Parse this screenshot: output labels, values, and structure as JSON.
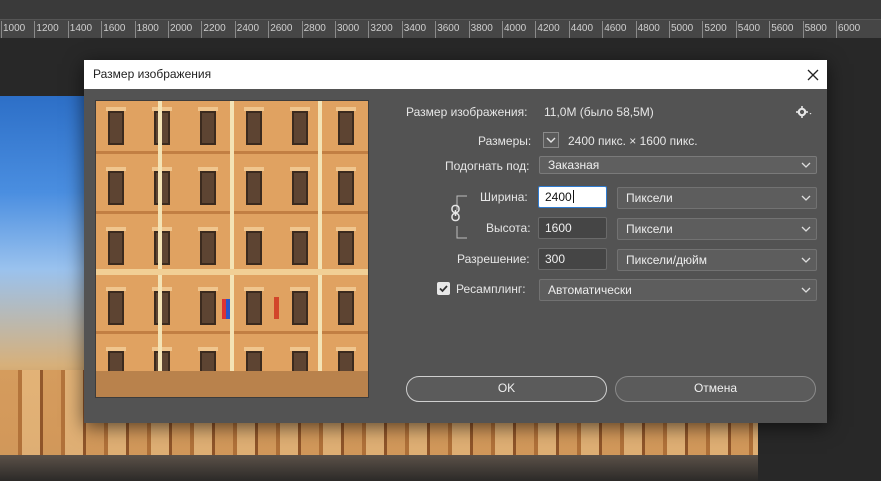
{
  "ruler": {
    "labels": [
      "1000",
      "1200",
      "1400",
      "1600",
      "1800",
      "2000",
      "2200",
      "2400",
      "2600",
      "2800",
      "3000",
      "3200",
      "3400",
      "3600",
      "3800",
      "4000",
      "4200",
      "4400",
      "4600",
      "4800",
      "5000",
      "5200",
      "5400",
      "5600",
      "5800",
      "6000"
    ]
  },
  "dialog": {
    "title": "Размер изображения",
    "image_size_label": "Размер изображения:",
    "image_size_value": "11,0M (было 58,5M)",
    "dimensions_label": "Размеры:",
    "dimensions_value": "2400 пикс.  ×  1600 пикс.",
    "fit_label": "Подогнать под:",
    "fit_value": "Заказная",
    "width_label": "Ширина:",
    "width_value": "2400",
    "width_unit": "Пиксели",
    "height_label": "Высота:",
    "height_value": "1600",
    "height_unit": "Пиксели",
    "resolution_label": "Разрешение:",
    "resolution_value": "300",
    "resolution_unit": "Пиксели/дюйм",
    "resample_label": "Ресамплинг:",
    "resample_checked": true,
    "resample_value": "Автоматически",
    "ok_label": "OK",
    "cancel_label": "Отмена"
  }
}
